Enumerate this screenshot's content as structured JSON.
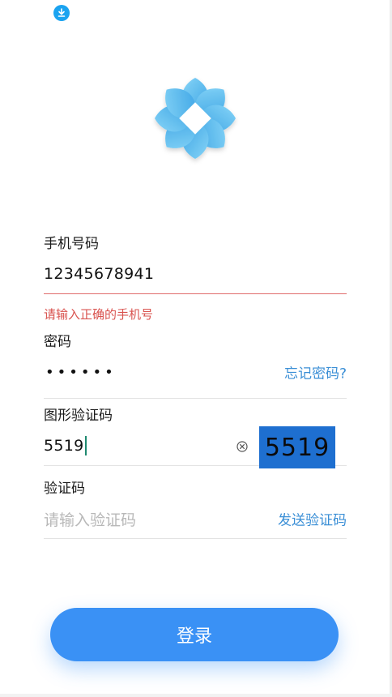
{
  "status_bar": {
    "download_icon": "download-icon",
    "accent": "#1aa3f0"
  },
  "logo": {
    "icon": "flower-logo-icon",
    "color": "#4fb8ee"
  },
  "phone": {
    "label": "手机号码",
    "value": "12345678941",
    "error": "请输入正确的手机号"
  },
  "password": {
    "label": "密码",
    "value": "••••••",
    "forgot_link": "忘记密码?"
  },
  "captcha": {
    "label": "图形验证码",
    "value": "5519",
    "image_text": "5519",
    "clear_icon": "clear-circle-icon"
  },
  "sms_code": {
    "label": "验证码",
    "placeholder": "请输入验证码",
    "send_link": "发送验证码"
  },
  "login": {
    "label": "登录",
    "color": "#3a91f5"
  }
}
